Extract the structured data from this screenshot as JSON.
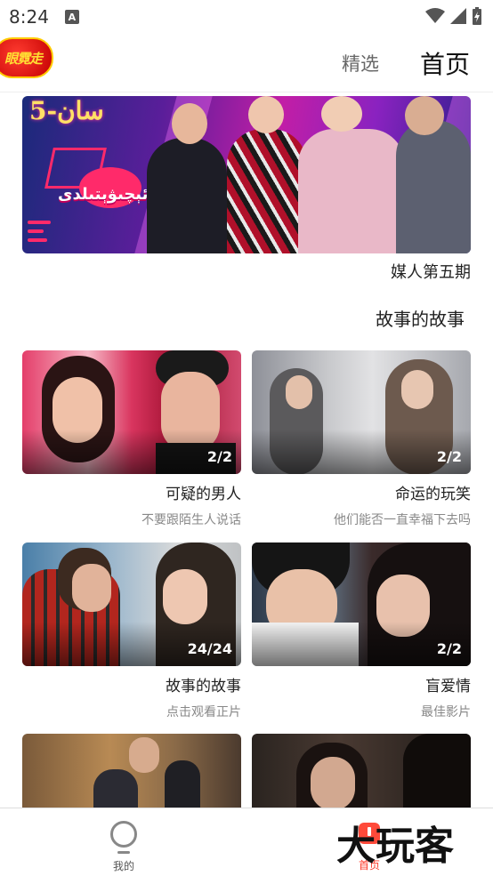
{
  "status_bar": {
    "time": "8:24",
    "notification_icon": "a-letter-icon",
    "indicators": [
      "wifi-icon",
      "cell-signal-icon",
      "battery-charging-icon"
    ]
  },
  "header": {
    "logo_text": "眼霓走",
    "tabs": [
      {
        "label": "精选",
        "active": false
      },
      {
        "label": "首页",
        "active": true
      }
    ]
  },
  "banner": {
    "caption": "媒人第五期",
    "overlay_text_top": "5-سان",
    "overlay_text_logo": "ھەقسىز ئېچىۋېتىلدى"
  },
  "section": {
    "title": "故事的故事"
  },
  "cards": [
    {
      "title": "可疑的男人",
      "subtitle": "不要跟陌生人说话",
      "episodes": "2/2"
    },
    {
      "title": "命运的玩笑",
      "subtitle": "他们能否一直幸福下去吗",
      "episodes": "2/2"
    },
    {
      "title": "故事的故事",
      "subtitle": "点击观看正片",
      "episodes": "24/24"
    },
    {
      "title": "盲爱情",
      "subtitle": "最佳影片",
      "episodes": "2/2"
    }
  ],
  "bottom_nav": {
    "items": [
      {
        "label": "我的",
        "icon": "profile-icon",
        "active": false
      },
      {
        "label": "首页",
        "icon": "home-icon",
        "active": true
      }
    ]
  },
  "watermark": {
    "text": "大玩客"
  },
  "colors": {
    "accent": "#ff3a2a",
    "text_primary": "#222222",
    "text_secondary": "#888888"
  }
}
